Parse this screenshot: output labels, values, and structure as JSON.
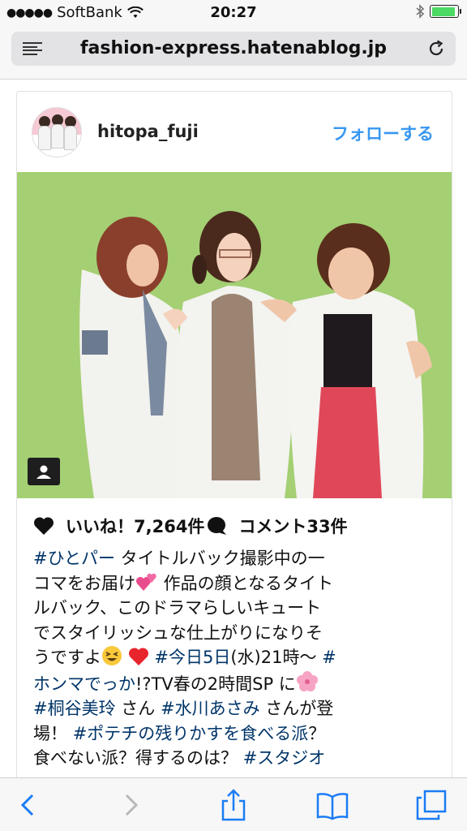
{
  "status": {
    "carrier": "SoftBank",
    "time": "20:27"
  },
  "browser": {
    "url": "fashion-express.hatenablog.jp"
  },
  "post": {
    "username": "hitopa_fuji",
    "follow_label": "フォローする",
    "likes_label": "いいね！7,264件",
    "comments_label": "コメント33件"
  },
  "caption": {
    "line1_tag": "#ひとパー",
    "line1_text": " タイトルバック撮影中の一",
    "line2_text": "コマをお届け",
    "line2_tail": " 作品の顔となるタイト",
    "line3_text": "ルバック、このドラマらしいキュート",
    "line4_text": "でスタイリッシュな仕上がりになりそ",
    "line5_text": "うですよ",
    "line5_tag": "#今日5日",
    "line5_mid": "(水)21時〜 ",
    "line5_tag2": "#",
    "line6_tag": "ホンマでっか",
    "line6_text": "!?TV春の2時間SP に",
    "line7_tag": "#桐谷美玲",
    "line7_mid": " さん ",
    "line7_tag2": "#水川あさみ",
    "line7_text": " さんが登",
    "line8_text": "場！ ",
    "line8_tag": "#ポテチの残りかすを食べる派",
    "line8_tail": "？",
    "line9_text": "食べない派？得するのは？ ",
    "line9_tag": "#スタジオ"
  },
  "colors": {
    "link": "#3897f0",
    "hashtag": "#003569",
    "toolbar_icon": "#1a7cf5",
    "screen_green": "#a4cf73"
  },
  "icons": {
    "menu": "reader-menu-icon",
    "reload": "reload-icon",
    "like": "heart-icon",
    "comment": "comment-icon",
    "tag": "user-tag-icon",
    "back": "back-icon",
    "forward": "forward-icon",
    "share": "share-icon",
    "bookmarks": "bookmarks-icon",
    "tabs": "tabs-icon"
  }
}
